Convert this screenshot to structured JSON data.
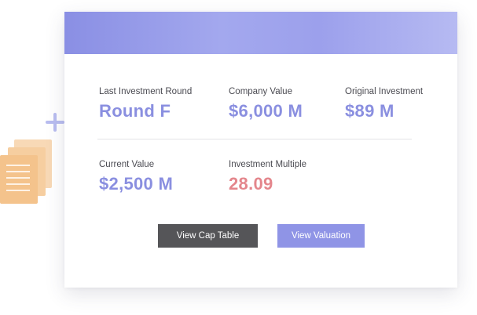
{
  "stats": {
    "last_investment_round": {
      "label": "Last Investment Round",
      "value": "Round F"
    },
    "company_value": {
      "label": "Company Value",
      "value": "$6,000 M"
    },
    "original_investment": {
      "label": "Original Investment",
      "value": "$89 M"
    },
    "current_value": {
      "label": "Current Value",
      "value": "$2,500 M"
    },
    "investment_multiple": {
      "label": "Investment Multiple",
      "value": "28.09"
    }
  },
  "actions": {
    "view_cap_table": "View Cap Table",
    "view_valuation": "View Valuation"
  },
  "colors": {
    "accent": "#8a8fe0",
    "highlight": "#e4868c",
    "dark_button": "#555558",
    "header_gradient_start": "#8a8fe4",
    "header_gradient_end": "#b6baf2",
    "deco_docs": "#f4c38c",
    "deco_plus": "#b9bdf0"
  },
  "icons": {
    "plus": "plus-icon",
    "documents": "documents-icon"
  }
}
